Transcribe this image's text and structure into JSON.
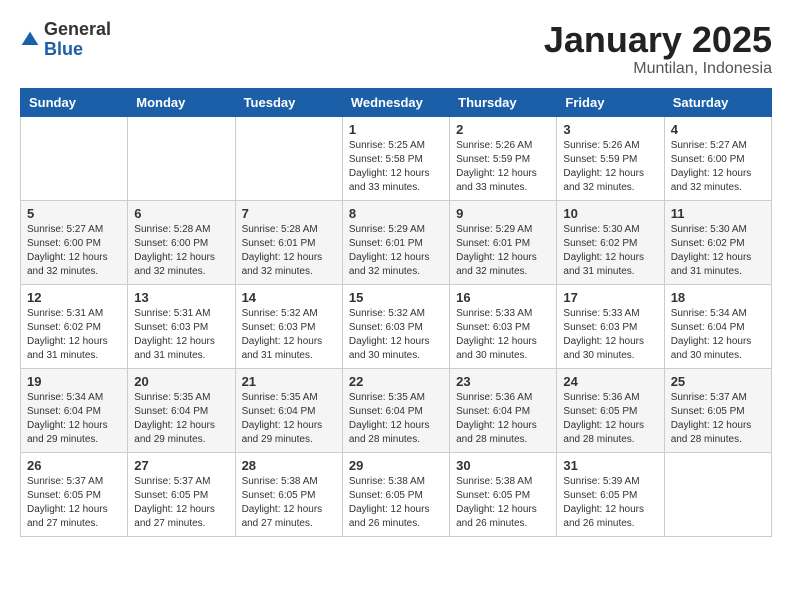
{
  "header": {
    "logo": {
      "general": "General",
      "blue": "Blue"
    },
    "title": "January 2025",
    "location": "Muntilan, Indonesia"
  },
  "weekdays": [
    "Sunday",
    "Monday",
    "Tuesday",
    "Wednesday",
    "Thursday",
    "Friday",
    "Saturday"
  ],
  "weeks": [
    [
      {
        "day": "",
        "info": ""
      },
      {
        "day": "",
        "info": ""
      },
      {
        "day": "",
        "info": ""
      },
      {
        "day": "1",
        "info": "Sunrise: 5:25 AM\nSunset: 5:58 PM\nDaylight: 12 hours\nand 33 minutes."
      },
      {
        "day": "2",
        "info": "Sunrise: 5:26 AM\nSunset: 5:59 PM\nDaylight: 12 hours\nand 33 minutes."
      },
      {
        "day": "3",
        "info": "Sunrise: 5:26 AM\nSunset: 5:59 PM\nDaylight: 12 hours\nand 32 minutes."
      },
      {
        "day": "4",
        "info": "Sunrise: 5:27 AM\nSunset: 6:00 PM\nDaylight: 12 hours\nand 32 minutes."
      }
    ],
    [
      {
        "day": "5",
        "info": "Sunrise: 5:27 AM\nSunset: 6:00 PM\nDaylight: 12 hours\nand 32 minutes."
      },
      {
        "day": "6",
        "info": "Sunrise: 5:28 AM\nSunset: 6:00 PM\nDaylight: 12 hours\nand 32 minutes."
      },
      {
        "day": "7",
        "info": "Sunrise: 5:28 AM\nSunset: 6:01 PM\nDaylight: 12 hours\nand 32 minutes."
      },
      {
        "day": "8",
        "info": "Sunrise: 5:29 AM\nSunset: 6:01 PM\nDaylight: 12 hours\nand 32 minutes."
      },
      {
        "day": "9",
        "info": "Sunrise: 5:29 AM\nSunset: 6:01 PM\nDaylight: 12 hours\nand 32 minutes."
      },
      {
        "day": "10",
        "info": "Sunrise: 5:30 AM\nSunset: 6:02 PM\nDaylight: 12 hours\nand 31 minutes."
      },
      {
        "day": "11",
        "info": "Sunrise: 5:30 AM\nSunset: 6:02 PM\nDaylight: 12 hours\nand 31 minutes."
      }
    ],
    [
      {
        "day": "12",
        "info": "Sunrise: 5:31 AM\nSunset: 6:02 PM\nDaylight: 12 hours\nand 31 minutes."
      },
      {
        "day": "13",
        "info": "Sunrise: 5:31 AM\nSunset: 6:03 PM\nDaylight: 12 hours\nand 31 minutes."
      },
      {
        "day": "14",
        "info": "Sunrise: 5:32 AM\nSunset: 6:03 PM\nDaylight: 12 hours\nand 31 minutes."
      },
      {
        "day": "15",
        "info": "Sunrise: 5:32 AM\nSunset: 6:03 PM\nDaylight: 12 hours\nand 30 minutes."
      },
      {
        "day": "16",
        "info": "Sunrise: 5:33 AM\nSunset: 6:03 PM\nDaylight: 12 hours\nand 30 minutes."
      },
      {
        "day": "17",
        "info": "Sunrise: 5:33 AM\nSunset: 6:03 PM\nDaylight: 12 hours\nand 30 minutes."
      },
      {
        "day": "18",
        "info": "Sunrise: 5:34 AM\nSunset: 6:04 PM\nDaylight: 12 hours\nand 30 minutes."
      }
    ],
    [
      {
        "day": "19",
        "info": "Sunrise: 5:34 AM\nSunset: 6:04 PM\nDaylight: 12 hours\nand 29 minutes."
      },
      {
        "day": "20",
        "info": "Sunrise: 5:35 AM\nSunset: 6:04 PM\nDaylight: 12 hours\nand 29 minutes."
      },
      {
        "day": "21",
        "info": "Sunrise: 5:35 AM\nSunset: 6:04 PM\nDaylight: 12 hours\nand 29 minutes."
      },
      {
        "day": "22",
        "info": "Sunrise: 5:35 AM\nSunset: 6:04 PM\nDaylight: 12 hours\nand 28 minutes."
      },
      {
        "day": "23",
        "info": "Sunrise: 5:36 AM\nSunset: 6:04 PM\nDaylight: 12 hours\nand 28 minutes."
      },
      {
        "day": "24",
        "info": "Sunrise: 5:36 AM\nSunset: 6:05 PM\nDaylight: 12 hours\nand 28 minutes."
      },
      {
        "day": "25",
        "info": "Sunrise: 5:37 AM\nSunset: 6:05 PM\nDaylight: 12 hours\nand 28 minutes."
      }
    ],
    [
      {
        "day": "26",
        "info": "Sunrise: 5:37 AM\nSunset: 6:05 PM\nDaylight: 12 hours\nand 27 minutes."
      },
      {
        "day": "27",
        "info": "Sunrise: 5:37 AM\nSunset: 6:05 PM\nDaylight: 12 hours\nand 27 minutes."
      },
      {
        "day": "28",
        "info": "Sunrise: 5:38 AM\nSunset: 6:05 PM\nDaylight: 12 hours\nand 27 minutes."
      },
      {
        "day": "29",
        "info": "Sunrise: 5:38 AM\nSunset: 6:05 PM\nDaylight: 12 hours\nand 26 minutes."
      },
      {
        "day": "30",
        "info": "Sunrise: 5:38 AM\nSunset: 6:05 PM\nDaylight: 12 hours\nand 26 minutes."
      },
      {
        "day": "31",
        "info": "Sunrise: 5:39 AM\nSunset: 6:05 PM\nDaylight: 12 hours\nand 26 minutes."
      },
      {
        "day": "",
        "info": ""
      }
    ]
  ]
}
